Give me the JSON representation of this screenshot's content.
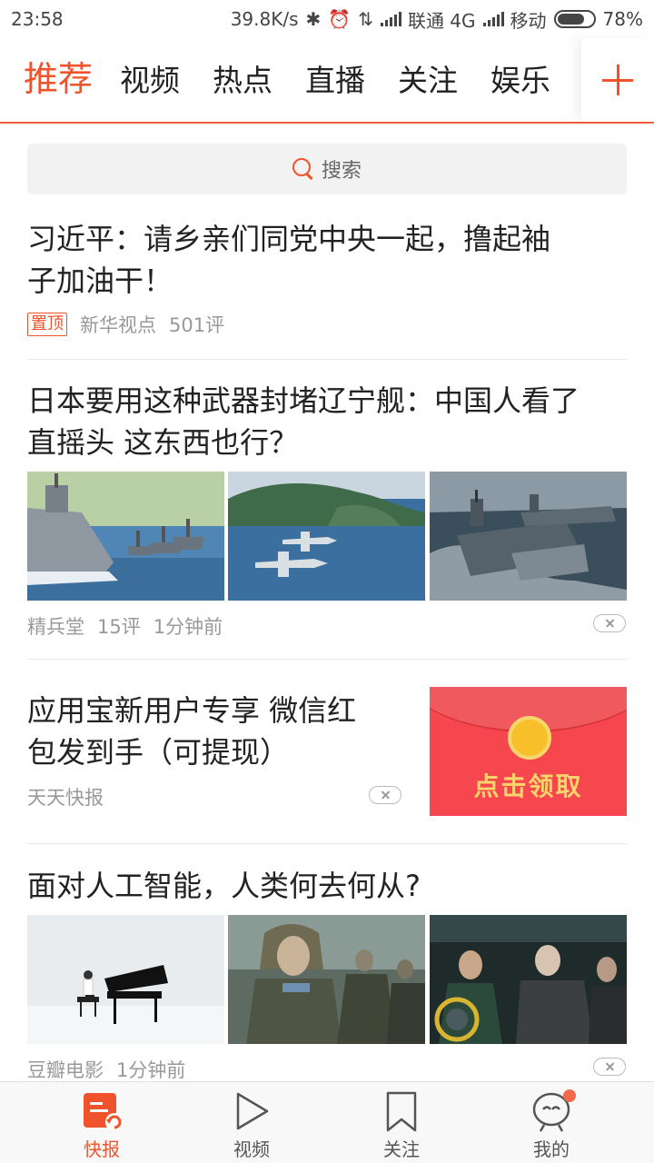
{
  "status_bar": {
    "time": "23:58",
    "speed": "39.8K/s",
    "carrier1": "联通 4G",
    "carrier2": "移动",
    "battery": "78%",
    "battery_level": 0.78
  },
  "tabs": [
    "推荐",
    "视频",
    "热点",
    "直播",
    "关注",
    "娱乐"
  ],
  "search": {
    "placeholder": "搜索"
  },
  "feed": [
    {
      "title_line1": "习近平：请乡亲们同党中央一起，撸起袖",
      "title_line2": "子加油干！",
      "pin": "置顶",
      "source": "新华视点",
      "comments": "501评"
    },
    {
      "title_line1": "日本要用这种武器封堵辽宁舰：中国人看了",
      "title_line2": "直摇头 这东西也行？",
      "source": "精兵堂",
      "comments": "15评",
      "time": "1分钟前"
    },
    {
      "title_line1": "应用宝新用户专享 微信红",
      "title_line2": "包发到手（可提现）",
      "source": "天天快报",
      "ad_text": "点击领取"
    },
    {
      "title_line1": "面对人工智能，人类何去何从?",
      "source": "豆瓣电影",
      "time": "1分钟前"
    }
  ],
  "bottom_nav": [
    "快报",
    "视频",
    "关注",
    "我的"
  ],
  "colors": {
    "accent": "#f0532b",
    "ad_red": "#f5474d",
    "coin": "#f7c02b"
  }
}
